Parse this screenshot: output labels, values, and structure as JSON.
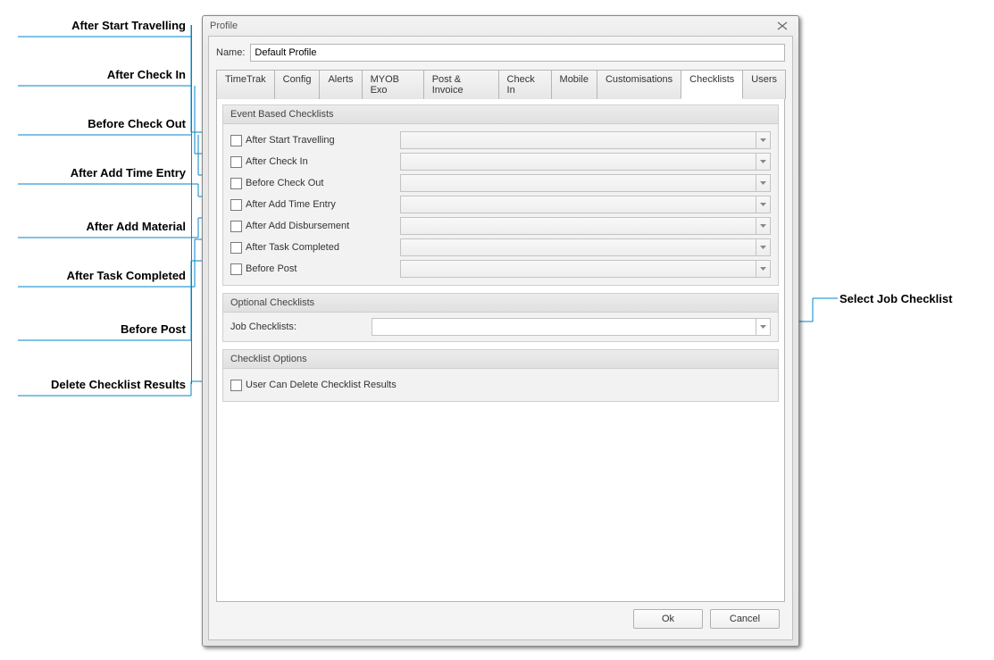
{
  "dialog": {
    "title": "Profile",
    "name_label": "Name:",
    "name_value": "Default Profile",
    "tabs": [
      "TimeTrak",
      "Config",
      "Alerts",
      "MYOB Exo",
      "Post & Invoice",
      "Check In",
      "Mobile",
      "Customisations",
      "Checklists",
      "Users"
    ],
    "active_tab": "Checklists"
  },
  "event_group": {
    "title": "Event Based Checklists",
    "items": [
      {
        "label": "After Start Travelling",
        "checked": false
      },
      {
        "label": "After Check In",
        "checked": false
      },
      {
        "label": "Before Check Out",
        "checked": false
      },
      {
        "label": "After Add Time Entry",
        "checked": false
      },
      {
        "label": "After Add Disbursement",
        "checked": false
      },
      {
        "label": "After Task Completed",
        "checked": false
      },
      {
        "label": "Before Post",
        "checked": false
      }
    ]
  },
  "optional_group": {
    "title": "Optional Checklists",
    "job_label": "Job Checklists:"
  },
  "options_group": {
    "title": "Checklist Options",
    "delete_label": "User Can Delete Checklist Results",
    "delete_checked": false
  },
  "footer": {
    "ok": "Ok",
    "cancel": "Cancel"
  },
  "annotations": {
    "left": [
      "After Start Travelling",
      "After Check In",
      "Before Check Out",
      "After Add Time Entry",
      "After Add Material",
      "After Task Completed",
      "Before Post",
      "Delete Checklist Results"
    ],
    "right": "Select Job Checklist"
  }
}
